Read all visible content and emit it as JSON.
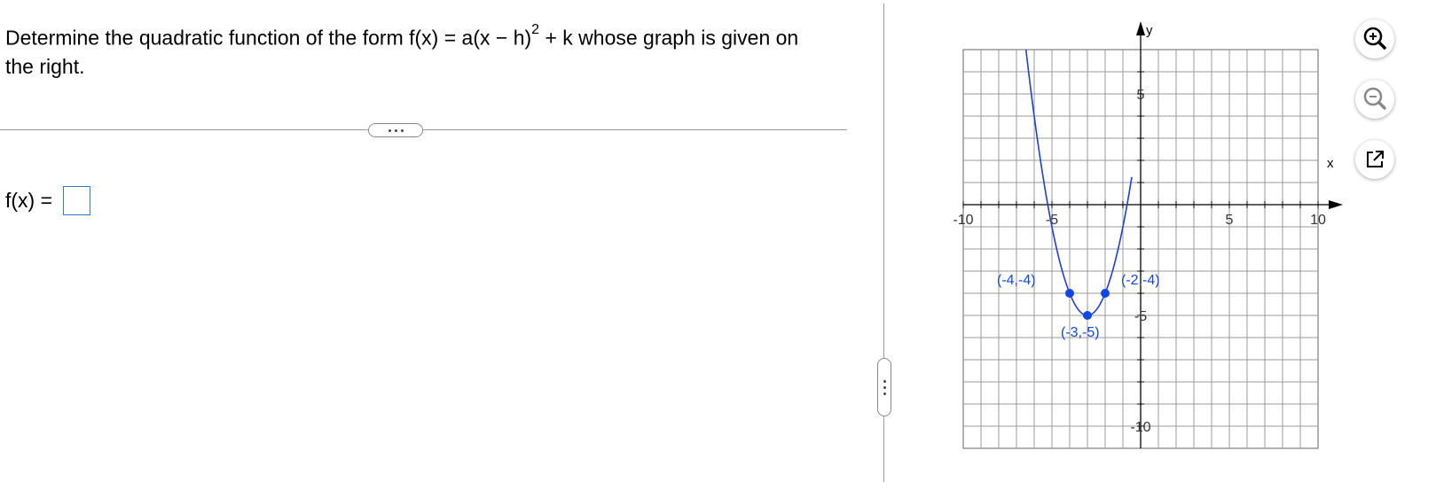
{
  "question": {
    "prefix": "Determine the quadratic function of the form f(x) = a(x − h)",
    "exponent": "2",
    "suffix": " + k whose graph is given on the right."
  },
  "answer": {
    "label": "f(x) =",
    "value": ""
  },
  "graph": {
    "x_axis_label": "x",
    "y_axis_label": "y",
    "x_ticks": [
      "-10",
      "-5",
      "5",
      "10"
    ],
    "y_ticks": [
      "5",
      "-5",
      "-10"
    ],
    "points": [
      {
        "x": -4,
        "y": -4,
        "label": "(-4,-4)"
      },
      {
        "x": -2,
        "y": -4,
        "label": "(-2,-4)"
      },
      {
        "x": -3,
        "y": -5,
        "label": "(-3,-5)"
      }
    ],
    "curve_color": "#1f3fd6",
    "point_color": "#1046e8"
  },
  "tools": {
    "zoom_in": "zoom-in-icon",
    "zoom_out": "zoom-out-icon",
    "popout": "popout-icon"
  }
}
